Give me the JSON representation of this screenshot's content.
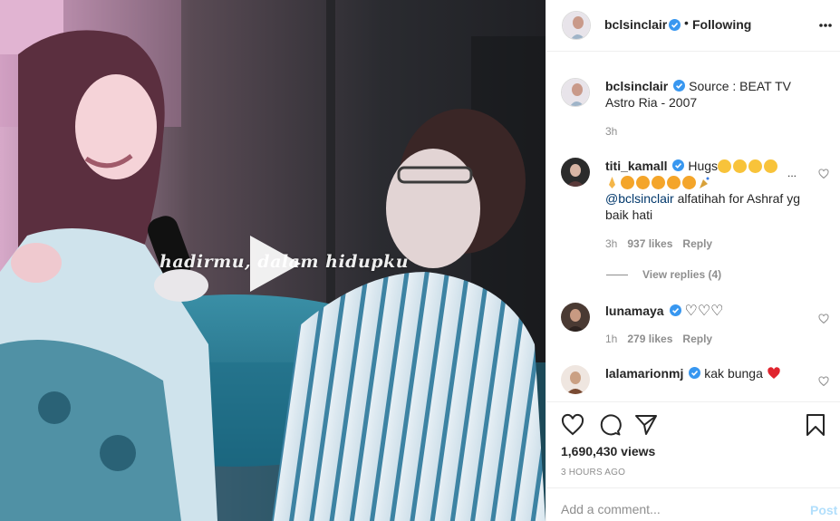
{
  "post": {
    "author": "bclsinclair",
    "follow_status": "Following",
    "separator": "•",
    "video_overlay_text": "hadirmu, dalam hidupku",
    "caption": "Source : BEAT TV Astro Ria - 2007",
    "caption_age": "3h",
    "views": "1,690,430 views",
    "posted": "3 HOURS AGO"
  },
  "comments": [
    {
      "username": "titi_kamall",
      "text_prefix": "Hugs",
      "mention": "@bclsinclair",
      "text_suffix": "alfatihah for Ashraf yg baik hati",
      "age": "3h",
      "likes": "937 likes",
      "reply": "Reply",
      "view_replies": "View replies (4)",
      "overflow": "..."
    },
    {
      "username": "lunamaya",
      "text": "♡♡♡",
      "age": "1h",
      "likes": "279 likes",
      "reply": "Reply"
    },
    {
      "username": "lalamarionmj",
      "text": "kak bunga"
    }
  ],
  "composer": {
    "placeholder": "Add a comment...",
    "post_label": "Post"
  },
  "icons": [
    "verified-badge-icon",
    "more-options-icon",
    "heart-icon",
    "comment-icon",
    "share-icon",
    "bookmark-icon",
    "play-icon"
  ],
  "colors": {
    "verified_blue": "#3897f0",
    "post_button_disabled": "#b2dffc",
    "secondary_text": "#8e8e8e",
    "heart_red": "#ed4956"
  }
}
